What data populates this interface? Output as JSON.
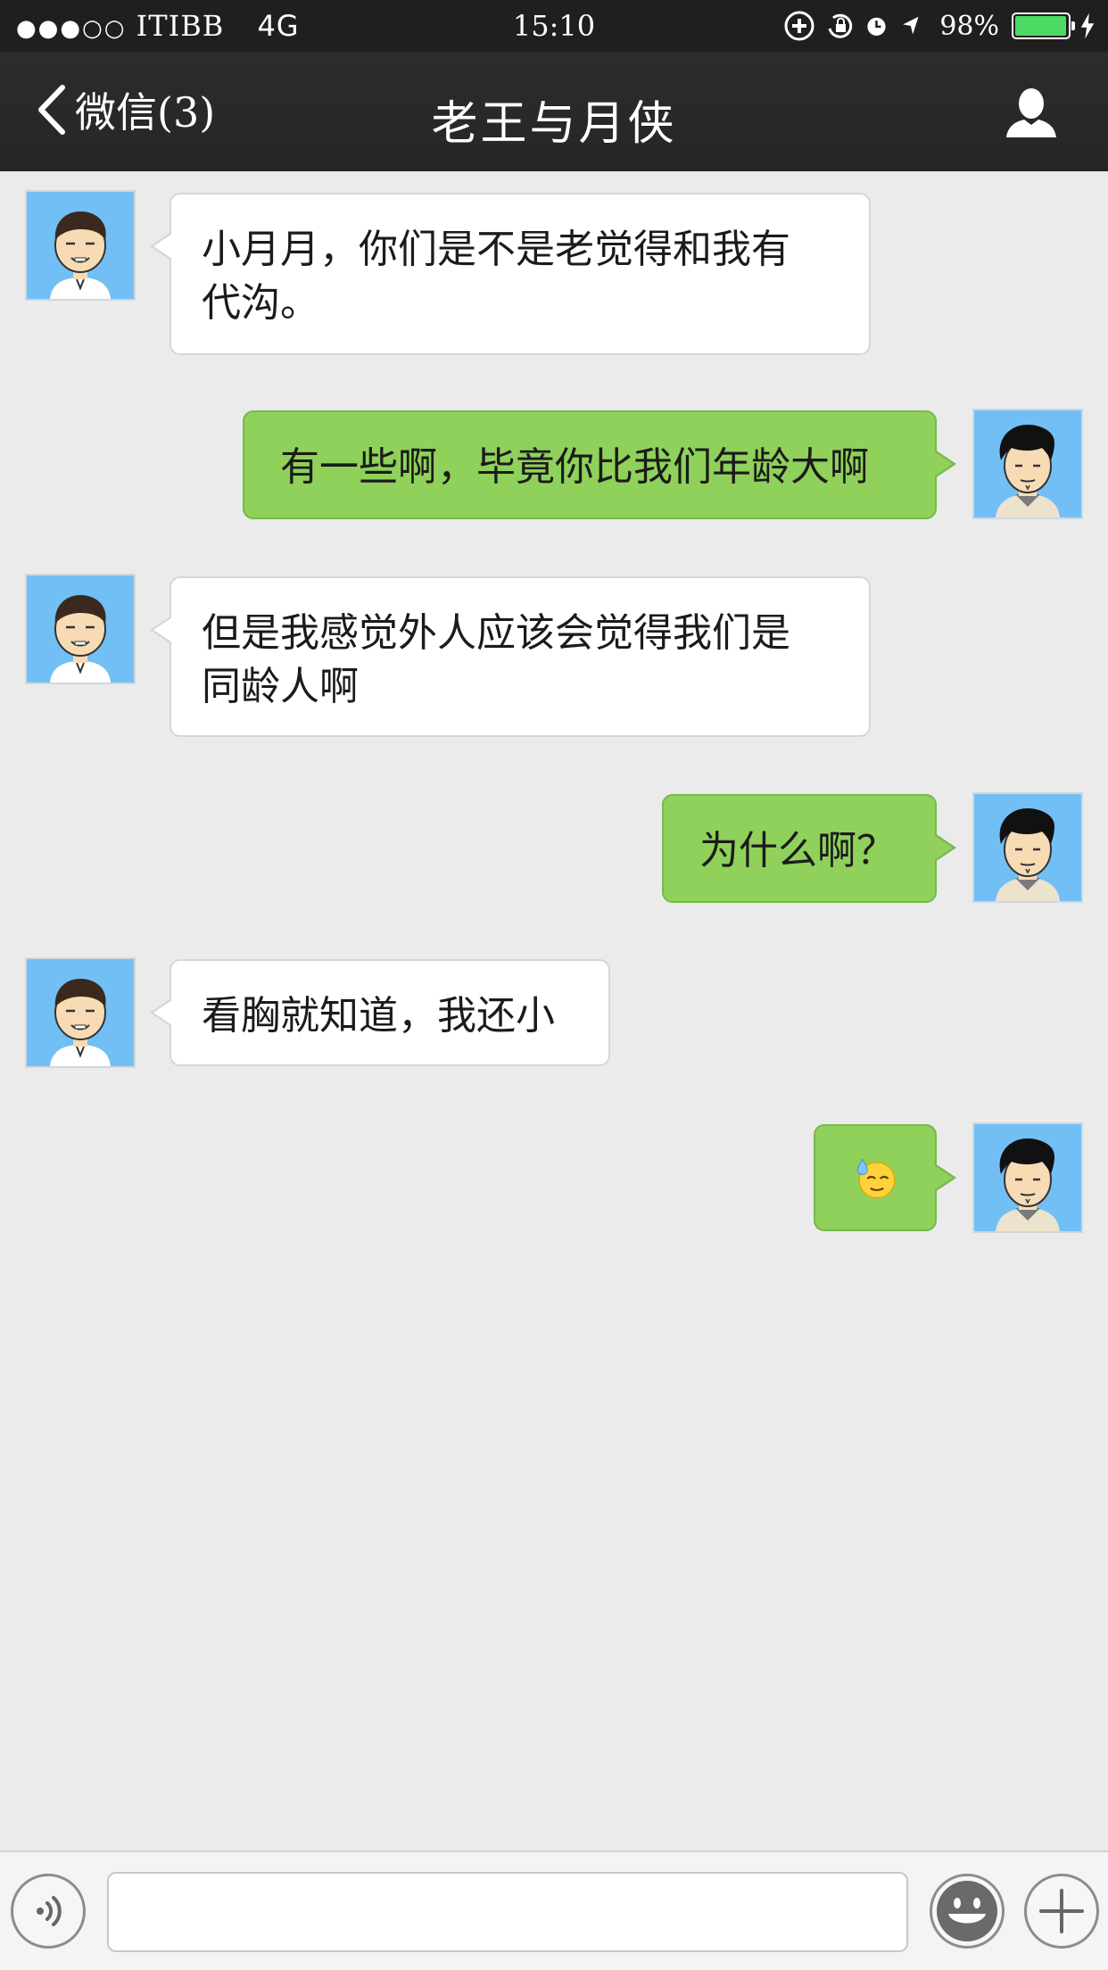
{
  "status_bar": {
    "signal": "●●●○○",
    "carrier": "ITIBB",
    "network": "4G",
    "time": "15:10",
    "battery_percent": "98%",
    "battery_level": 0.98,
    "icons": [
      "add-circle-icon",
      "orientation-lock-icon",
      "alarm-icon",
      "location-arrow-icon",
      "battery-icon",
      "charging-bolt-icon"
    ]
  },
  "nav": {
    "back_label": "微信(3)",
    "title": "老王与月侠",
    "profile_icon": "person-icon"
  },
  "messages": [
    {
      "from": "other",
      "text": "小月月，你们是不是老觉得和我有\n代沟。"
    },
    {
      "from": "me",
      "text": "有一些啊，毕竟你比我们年龄大啊"
    },
    {
      "from": "other",
      "text": "但是我感觉外人应该会觉得我们是\n同龄人啊"
    },
    {
      "from": "me",
      "text": "为什么啊？"
    },
    {
      "from": "other",
      "text": "看胸就知道，我还小"
    },
    {
      "from": "me",
      "text": "",
      "emoji": "sweat-smile-emoji"
    }
  ],
  "input_bar": {
    "voice_icon": "voice-icon",
    "emoji_icon": "smiley-icon",
    "plus_icon": "plus-icon",
    "input_value": ""
  },
  "colors": {
    "background": "#ebebeb",
    "navbar": "#262626",
    "outgoing_bubble": "#8fd15a",
    "incoming_bubble": "#ffffff",
    "avatar_bg": "#72bff5"
  }
}
